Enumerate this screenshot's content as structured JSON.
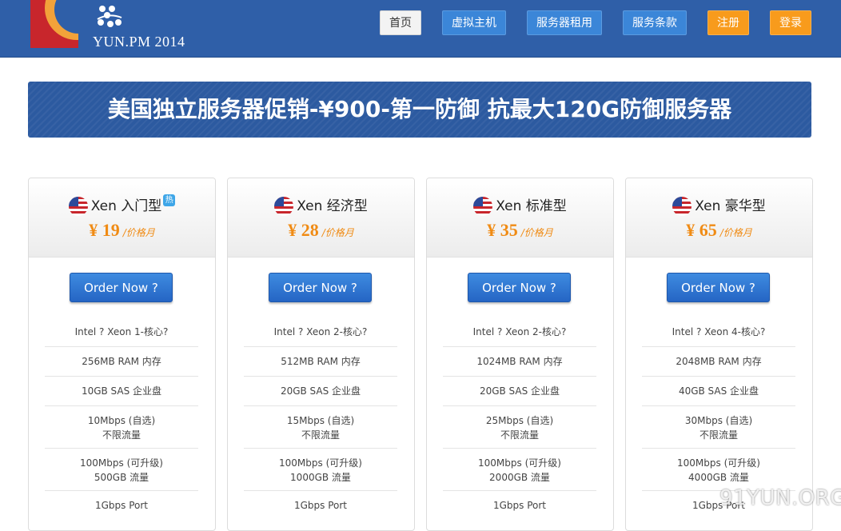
{
  "header": {
    "logo_text": "YUN.PM  2014",
    "nav": {
      "home": "首页",
      "vps": "虚拟主机",
      "server_rental": "服务器租用",
      "terms": "服务条款",
      "register": "注册",
      "login": "登录"
    }
  },
  "banner": {
    "text": "美国独立服务器促销-¥900-第一防御  抗最大120G防御服务器"
  },
  "plans": [
    {
      "name": "Xen 入门型",
      "hot_badge": "热",
      "price": "¥ 19",
      "unit": "/价格月",
      "order": "Order Now ?",
      "cpu": "Intel ? Xeon 1-核心?",
      "ram": "256MB RAM 内存",
      "disk": "10GB SAS 企业盘",
      "bw_line1": "10Mbps (自选)",
      "bw_line2": "不限流量",
      "port_line1": "100Mbps (可升级)",
      "port_line2": "500GB 流量",
      "uplink": "1Gbps Port"
    },
    {
      "name": "Xen 经济型",
      "price": "¥ 28",
      "unit": "/价格月",
      "order": "Order Now ?",
      "cpu": "Intel ? Xeon 2-核心?",
      "ram": "512MB RAM 内存",
      "disk": "20GB SAS 企业盘",
      "bw_line1": "15Mbps (自选)",
      "bw_line2": "不限流量",
      "port_line1": "100Mbps (可升级)",
      "port_line2": "1000GB 流量",
      "uplink": "1Gbps Port"
    },
    {
      "name": "Xen 标准型",
      "price": "¥ 35",
      "unit": "/价格月",
      "order": "Order Now ?",
      "cpu": "Intel ? Xeon 2-核心?",
      "ram": "1024MB RAM 内存",
      "disk": "20GB SAS 企业盘",
      "bw_line1": "25Mbps (自选)",
      "bw_line2": "不限流量",
      "port_line1": "100Mbps (可升级)",
      "port_line2": "2000GB 流量",
      "uplink": "1Gbps Port"
    },
    {
      "name": "Xen 豪华型",
      "price": "¥ 65",
      "unit": "/价格月",
      "order": "Order Now ?",
      "cpu": "Intel ? Xeon 4-核心?",
      "ram": "2048MB RAM 内存",
      "disk": "40GB SAS 企业盘",
      "bw_line1": "30Mbps (自选)",
      "bw_line2": "不限流量",
      "port_line1": "100Mbps (可升级)",
      "port_line2": "4000GB 流量",
      "uplink": "1Gbps Port"
    }
  ],
  "watermark": "91YUN.ORG",
  "colors": {
    "header_bg": "#2f5fa8",
    "nav_blue": "#3b86d8",
    "nav_orange": "#f89b1c",
    "price": "#f08b14",
    "banner_bg": "#2c5aa0"
  },
  "icons": {
    "logo": "yun-logo",
    "flag": "us-flag-icon",
    "hot": "hot-badge-icon"
  }
}
